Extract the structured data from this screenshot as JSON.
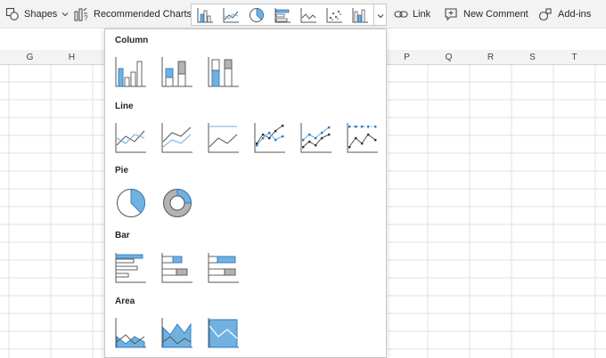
{
  "ribbon": {
    "shapes_label": "Shapes",
    "recommended_charts_label": "Recommended Charts",
    "link_label": "Link",
    "new_comment_label": "New Comment",
    "addins_label": "Add-ins"
  },
  "columns": [
    "G",
    "H",
    "P",
    "Q",
    "R",
    "S",
    "T"
  ],
  "dropdown": {
    "sections": [
      {
        "title": "Column",
        "options": [
          "clustered-column",
          "stacked-column",
          "100-stacked-column"
        ]
      },
      {
        "title": "Line",
        "options": [
          "line",
          "stacked-line",
          "100-stacked-line",
          "line-markers",
          "stacked-line-markers",
          "100-stacked-line-markers"
        ]
      },
      {
        "title": "Pie",
        "options": [
          "pie",
          "doughnut"
        ]
      },
      {
        "title": "Bar",
        "options": [
          "clustered-bar",
          "stacked-bar",
          "100-stacked-bar"
        ]
      },
      {
        "title": "Area",
        "options": [
          "area",
          "stacked-area",
          "100-stacked-area"
        ]
      }
    ]
  },
  "colors": {
    "accent": "#71b1e0",
    "accent_dark": "#2b78c0",
    "gray": "#b3b3b3",
    "outline": "#555555"
  }
}
